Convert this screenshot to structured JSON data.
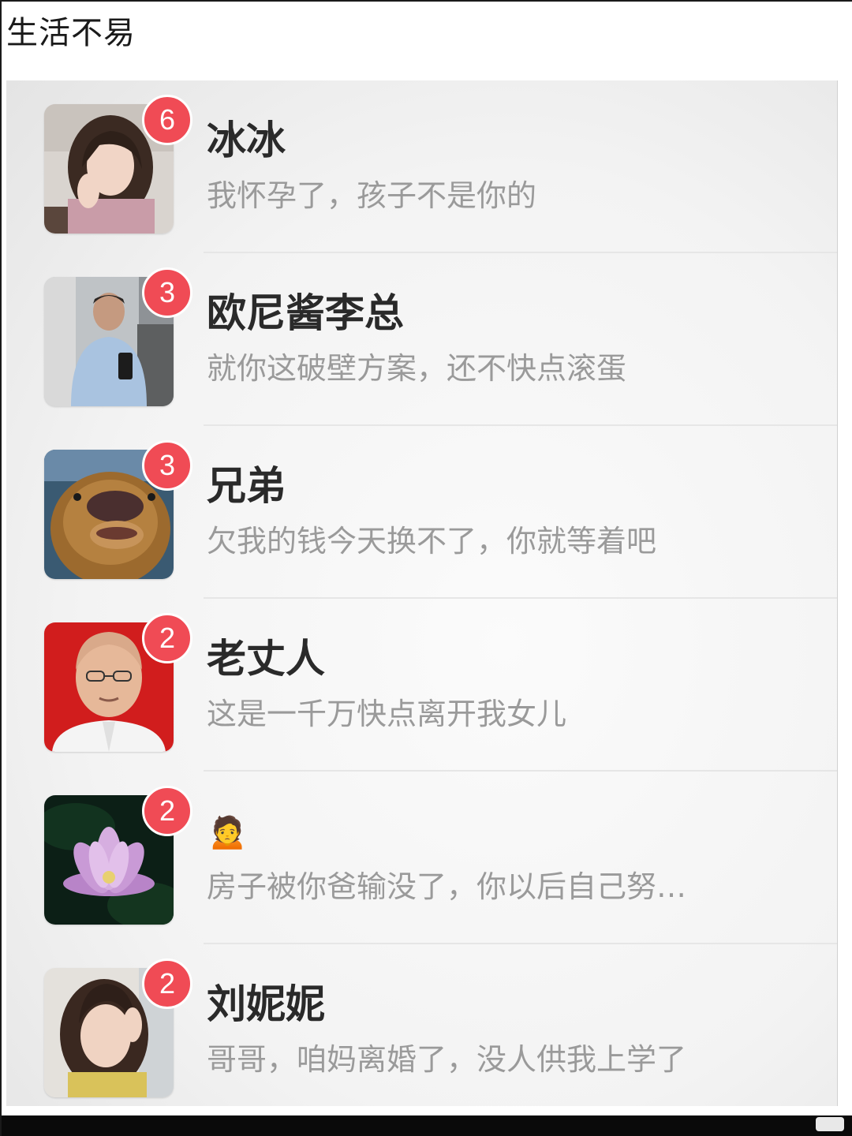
{
  "post_title": "生活不易",
  "chats": [
    {
      "name": "冰冰",
      "preview": "我怀孕了，孩子不是你的",
      "unread": "6",
      "avatar": "woman-portrait-avatar"
    },
    {
      "name": "欧尼酱李总",
      "preview": "就你这破壁方案，还不快点滚蛋",
      "unread": "3",
      "avatar": "man-in-jacket-avatar"
    },
    {
      "name": "兄弟",
      "preview": "欠我的钱今天换不了，你就等着吧",
      "unread": "3",
      "avatar": "cartoon-bear-avatar"
    },
    {
      "name": "老丈人",
      "preview": "这是一千万快点离开我女儿",
      "unread": "2",
      "avatar": "older-man-portrait-avatar"
    },
    {
      "name": "🙍",
      "preview": "房子被你爸输没了，你以后自己努…",
      "unread": "2",
      "avatar": "lotus-flower-avatar"
    },
    {
      "name": "刘妮妮",
      "preview": "哥哥，咱妈离婚了，没人供我上学了",
      "unread": "2",
      "avatar": "girl-portrait-avatar"
    }
  ],
  "colors": {
    "badge": "#f04b55",
    "name_text": "#2a2a2a",
    "preview_text": "#9a9a9a"
  }
}
